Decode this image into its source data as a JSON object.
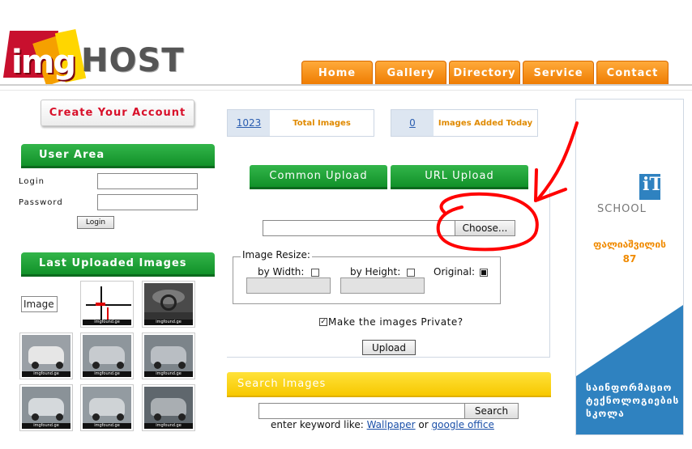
{
  "logo": {
    "img": "img",
    "host": "HOST"
  },
  "nav": [
    {
      "label": "Home"
    },
    {
      "label": "Gallery"
    },
    {
      "label": "Directory"
    },
    {
      "label": "Service"
    },
    {
      "label": "Contact"
    }
  ],
  "sidebar": {
    "create_account": "Create Your Account",
    "user_area": {
      "title": "User Area",
      "login_label": "Login",
      "password_label": "Password",
      "login_button": "Login"
    },
    "last_uploaded": {
      "title": "Last Uploaded Images",
      "broken_alt": "Image",
      "thumb_caption": "imgfound.ge"
    }
  },
  "stats": {
    "total_images": {
      "value": "1023",
      "label": "Total Images"
    },
    "today": {
      "value": "0",
      "label": "Images Added Today"
    }
  },
  "upload": {
    "tabs": [
      {
        "label": "Common Upload"
      },
      {
        "label": "URL Upload"
      }
    ],
    "choose_button": "Choose...",
    "resize": {
      "legend": "Image Resize:",
      "by_width": "by Width:",
      "by_height": "by Height:",
      "original": "Original:"
    },
    "private_label": "Make the images Private?",
    "private_checked": true,
    "upload_button": "Upload"
  },
  "search": {
    "title": "Search Images",
    "button": "Search",
    "hint_prefix": "enter keyword like: ",
    "hint_link1": "Wallpaper",
    "hint_or": " or ",
    "hint_link2": "google office"
  },
  "ad": {
    "school": "SCHOOL",
    "logo_letters": "iT",
    "line1": "ფალიაშვილის",
    "line2": "87",
    "blue_line1": "საინფორმაციო",
    "blue_line2": "ტექნოლოგიების",
    "blue_line3": "სკოლა"
  },
  "colors": {
    "nav_orange": "#ee7b00",
    "green": "#119129",
    "yellow": "#f7c800",
    "accent_red": "#d8102a",
    "annotation_red": "#ff0000",
    "ad_blue": "#2f82c0"
  }
}
